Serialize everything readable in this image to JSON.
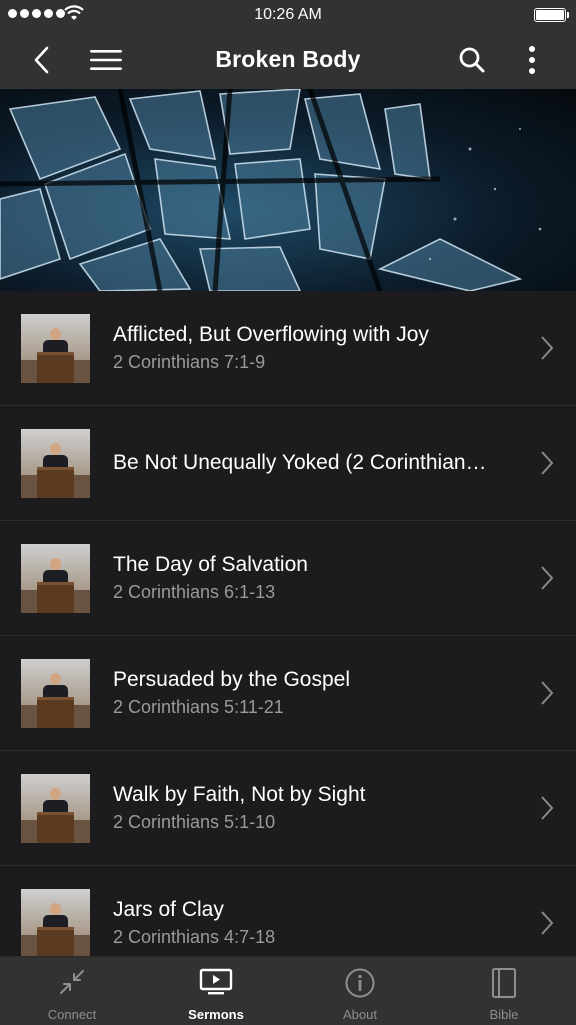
{
  "status": {
    "time": "10:26 AM"
  },
  "header": {
    "title": "Broken Body",
    "icons": [
      "back-icon",
      "menu-icon",
      "search-icon",
      "more-icon"
    ]
  },
  "sermons": [
    {
      "title": "Afflicted, But Overflowing with Joy",
      "passage": "2 Corinthians 7:1-9"
    },
    {
      "title": "Be Not Unequally Yoked (2 Corinthian…",
      "passage": ""
    },
    {
      "title": "The Day of Salvation",
      "passage": "2 Corinthians 6:1-13"
    },
    {
      "title": "Persuaded by the Gospel",
      "passage": "2 Corinthians 5:11-21"
    },
    {
      "title": "Walk by Faith, Not by Sight",
      "passage": "2 Corinthians 5:1-10"
    },
    {
      "title": "Jars of Clay",
      "passage": "2 Corinthians 4:7-18"
    }
  ],
  "tabs": [
    {
      "label": "Connect",
      "icon": "connect-icon",
      "active": false
    },
    {
      "label": "Sermons",
      "icon": "sermons-icon",
      "active": true
    },
    {
      "label": "About",
      "icon": "about-icon",
      "active": false
    },
    {
      "label": "Bible",
      "icon": "bible-icon",
      "active": false
    }
  ],
  "colors": {
    "bar_background": "#323232",
    "list_background": "#1c1c1e",
    "subtitle_text": "#9a9a9a",
    "inactive_tab": "#8e8e8e"
  }
}
